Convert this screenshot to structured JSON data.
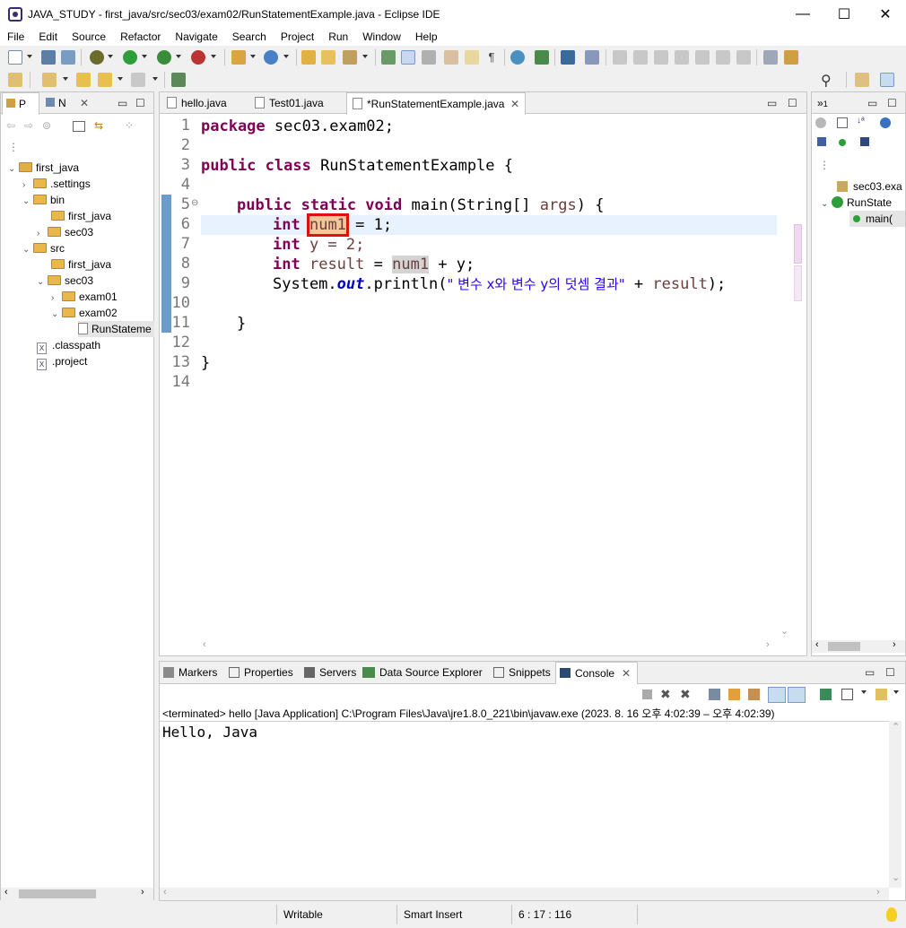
{
  "window": {
    "title": "JAVA_STUDY - first_java/src/sec03/exam02/RunStatementExample.java - Eclipse IDE",
    "minimize": "—",
    "maximize": "☐",
    "close": "✕"
  },
  "menu": [
    "File",
    "Edit",
    "Source",
    "Refactor",
    "Navigate",
    "Search",
    "Project",
    "Run",
    "Window",
    "Help"
  ],
  "left_panel": {
    "tabs": [
      "P",
      "N"
    ],
    "tree": [
      {
        "label": "first_java",
        "depth": 0,
        "type": "project",
        "expanded": true
      },
      {
        "label": ".settings",
        "depth": 1,
        "type": "folder",
        "expanded": false
      },
      {
        "label": "bin",
        "depth": 1,
        "type": "folder",
        "expanded": true
      },
      {
        "label": "first_java",
        "depth": 2,
        "type": "folder"
      },
      {
        "label": "sec03",
        "depth": 2,
        "type": "folder",
        "expanded": false
      },
      {
        "label": "src",
        "depth": 1,
        "type": "folder",
        "expanded": true
      },
      {
        "label": "first_java",
        "depth": 2,
        "type": "folder"
      },
      {
        "label": "sec03",
        "depth": 2,
        "type": "folder",
        "expanded": true
      },
      {
        "label": "exam01",
        "depth": 3,
        "type": "folder",
        "expanded": false
      },
      {
        "label": "exam02",
        "depth": 3,
        "type": "folder",
        "expanded": true
      },
      {
        "label": "RunStateme",
        "depth": 4,
        "type": "file",
        "selected": true
      },
      {
        "label": ".classpath",
        "depth": 1,
        "type": "xml"
      },
      {
        "label": ".project",
        "depth": 1,
        "type": "xml"
      }
    ]
  },
  "editor": {
    "tabs": [
      "hello.java",
      "Test01.java",
      "*RunStatementExample.java"
    ],
    "line_numbers": [
      "1",
      "2",
      "3",
      "4",
      "5",
      "6",
      "7",
      "8",
      "9",
      "10",
      "11",
      "12",
      "13",
      "14"
    ],
    "code": {
      "l1_kw": "package",
      "l1_rest": " sec03.exam02;",
      "l3_kw": "public class",
      "l3_rest": " RunStatementExample {",
      "l5_kw1": "public static void",
      "l5_mid": " main(String[] ",
      "l5_var": "args",
      "l5_end": ") {",
      "l6_kw": "int",
      "l6_var": "num1",
      "l6_end": " = 1;",
      "l7_kw": "int",
      "l7_rest": " y = 2;",
      "l8_kw": "int",
      "l8_var": "result",
      "l8_eq": " = ",
      "l8_num1": "num1",
      "l8_end": " + y;",
      "l9_a": "System.",
      "l9_out": "out",
      "l9_b": ".println(",
      "l9_str": "\" 변수 x와 변수 y의 덧셈 결과\"",
      "l9_plus": " + ",
      "l9_var": "result",
      "l9_end": ");",
      "l11": "}",
      "l13": "}"
    }
  },
  "outline": {
    "items": [
      "sec03.exa",
      "RunState",
      "main("
    ]
  },
  "bottom": {
    "tabs": [
      "Markers",
      "Properties",
      "Servers",
      "Data Source Explorer",
      "Snippets",
      "Console"
    ],
    "console_header": "<terminated> hello [Java Application] C:\\Program Files\\Java\\jre1.8.0_221\\bin\\javaw.exe  (2023. 8. 16 오후 4:02:39 – 오후 4:02:39)",
    "console_output": "Hello, Java"
  },
  "status": {
    "writable": "Writable",
    "insert_mode": "Smart Insert",
    "position": "6 : 17 : 116"
  }
}
